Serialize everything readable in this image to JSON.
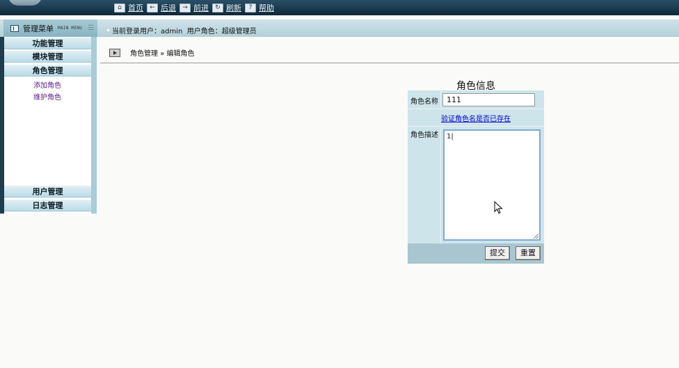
{
  "nav": {
    "items": [
      {
        "icon": "home-icon",
        "glyph": "⌂",
        "label": "首页"
      },
      {
        "icon": "back-icon",
        "glyph": "←",
        "label": "后退"
      },
      {
        "icon": "forward-icon",
        "glyph": "→",
        "label": "前进"
      },
      {
        "icon": "refresh-icon",
        "glyph": "↻",
        "label": "刷新"
      },
      {
        "icon": "help-icon",
        "glyph": "?",
        "label": "帮助"
      }
    ]
  },
  "menu_header": {
    "title": "管理菜单",
    "subtitle": "MAIN MENU"
  },
  "login_info": "当前登录用户：admin  用户角色：超级管理员",
  "sidebar": {
    "categories": [
      "功能管理",
      "模块管理",
      "角色管理"
    ],
    "submenu": [
      "添加角色",
      "维护角色"
    ],
    "bottom_categories": [
      "用户管理",
      "日志管理"
    ]
  },
  "breadcrumb": "角色管理 » 编辑角色",
  "form": {
    "title": "角色信息",
    "name_label": "角色名称",
    "name_value": "111",
    "verify_link": "验证角色名是否已存在",
    "desc_label": "角色描述",
    "desc_value": "1|",
    "submit_label": "提交",
    "reset_label": "重置"
  },
  "colors": {
    "topbar": "#163447",
    "sidebar_accent": "#a9ccd6",
    "form_bg": "#cde4ea",
    "link": "#0000cc",
    "submenu_link": "#5a1b8a"
  }
}
